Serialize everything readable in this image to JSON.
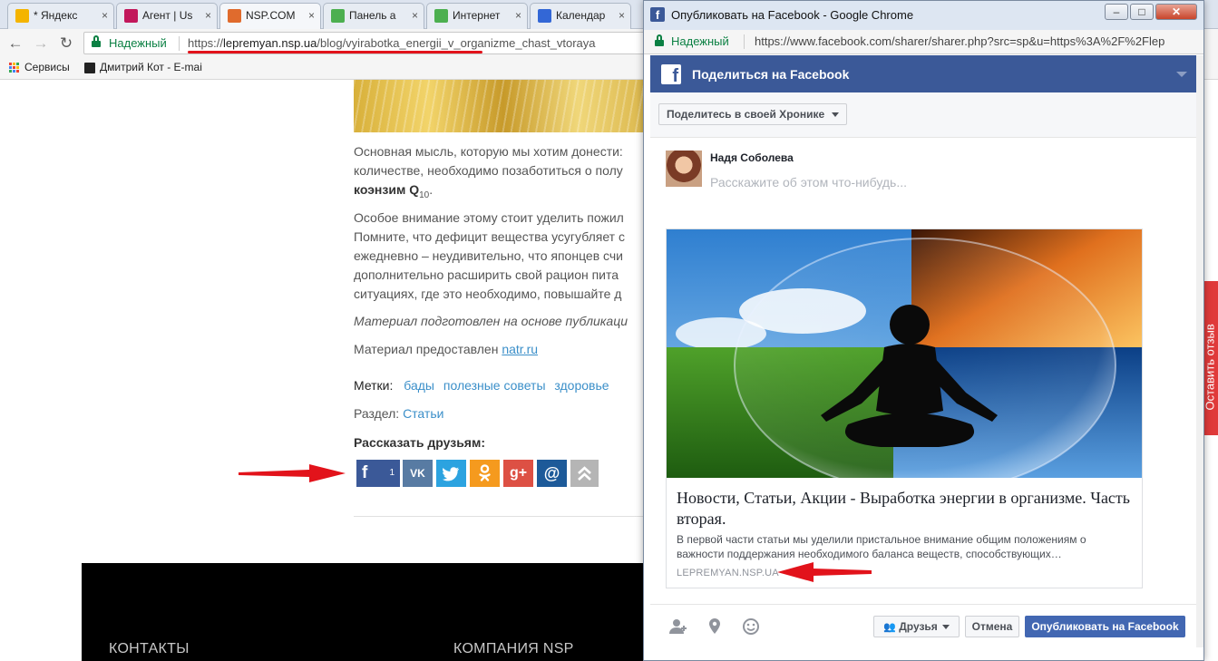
{
  "tabs": [
    {
      "title": "* Яндекс",
      "color": "#f4b400"
    },
    {
      "title": "Агент | Us",
      "color": "#c2185b"
    },
    {
      "title": "NSP.COM",
      "color": "#e06b2d"
    },
    {
      "title": "Панель а",
      "color": "#4caf50"
    },
    {
      "title": "Интернет",
      "color": "#4caf50"
    },
    {
      "title": "Календар",
      "color": "#3367d6"
    }
  ],
  "browser": {
    "secure_label": "Надежный",
    "url_scheme": "https://",
    "url_domain": "lepremyan.nsp.ua",
    "url_path": "/blog/vyirabotka_energii_v_organizme_chast_vtoraya"
  },
  "bookmarks": [
    "Сервисы",
    "Дмитрий Кот - E-mai"
  ],
  "article": {
    "p1_line1": "Основная мысль, которую мы хотим донести:",
    "p1_line2": "количестве, необходимо позаботиться о полу",
    "p1_line3": "коэнзим Q",
    "p1_sub": "10",
    "p1_dot": ".",
    "p2_lines": [
      "Особое внимание этому стоит уделить пожил",
      "Помните, что дефицит вещества усугубляет с",
      "ежедневно – неудивительно, что японцев счи",
      "дополнительно расширить свой рацион пита",
      "ситуациях, где это необходимо, повышайте д"
    ],
    "italic_note": "Материал подготовлен на основе публикаци",
    "provided_label": "Материал предоставлен",
    "provided_link": "natr.ru",
    "tags_label": "Метки:",
    "tags": [
      "бады",
      "полезные советы",
      "здоровье"
    ],
    "section_label": "Раздел:",
    "section_link": "Статьи",
    "share_title": "Рассказать друзьям:",
    "fb_count": "1"
  },
  "footer": {
    "contacts": "КОНТАКТЫ",
    "company": "КОМПАНИЯ NSP"
  },
  "feedback_tab": "Оставить отзыв",
  "popup": {
    "window_title": "Опубликовать на Facebook - Google Chrome",
    "secure_label": "Надежный",
    "url": "https://www.facebook.com/sharer/sharer.php?src=sp&u=https%3A%2F%2Flep",
    "header_title": "Поделиться на Facebook",
    "share_target": "Поделитесь в своей Хронике",
    "user_name": "Надя Соболева",
    "placeholder": "Расскажите об этом что-нибудь...",
    "card_title": "Новости, Статьи, Акции - Выработка энергии в организме. Часть вторая.",
    "card_desc": "В первой части статьи мы уделили пристальное внимание общим положениям о важности поддержания необходимого баланса веществ, способствующих…",
    "card_domain": "LEPREMYAN.NSP.UA",
    "audience": "Друзья",
    "cancel": "Отмена",
    "publish": "Опубликовать на Facebook"
  },
  "colors": {
    "facebook_blue": "#3b5998",
    "accent_red": "#e2131b",
    "secure_green": "#0b8043"
  }
}
